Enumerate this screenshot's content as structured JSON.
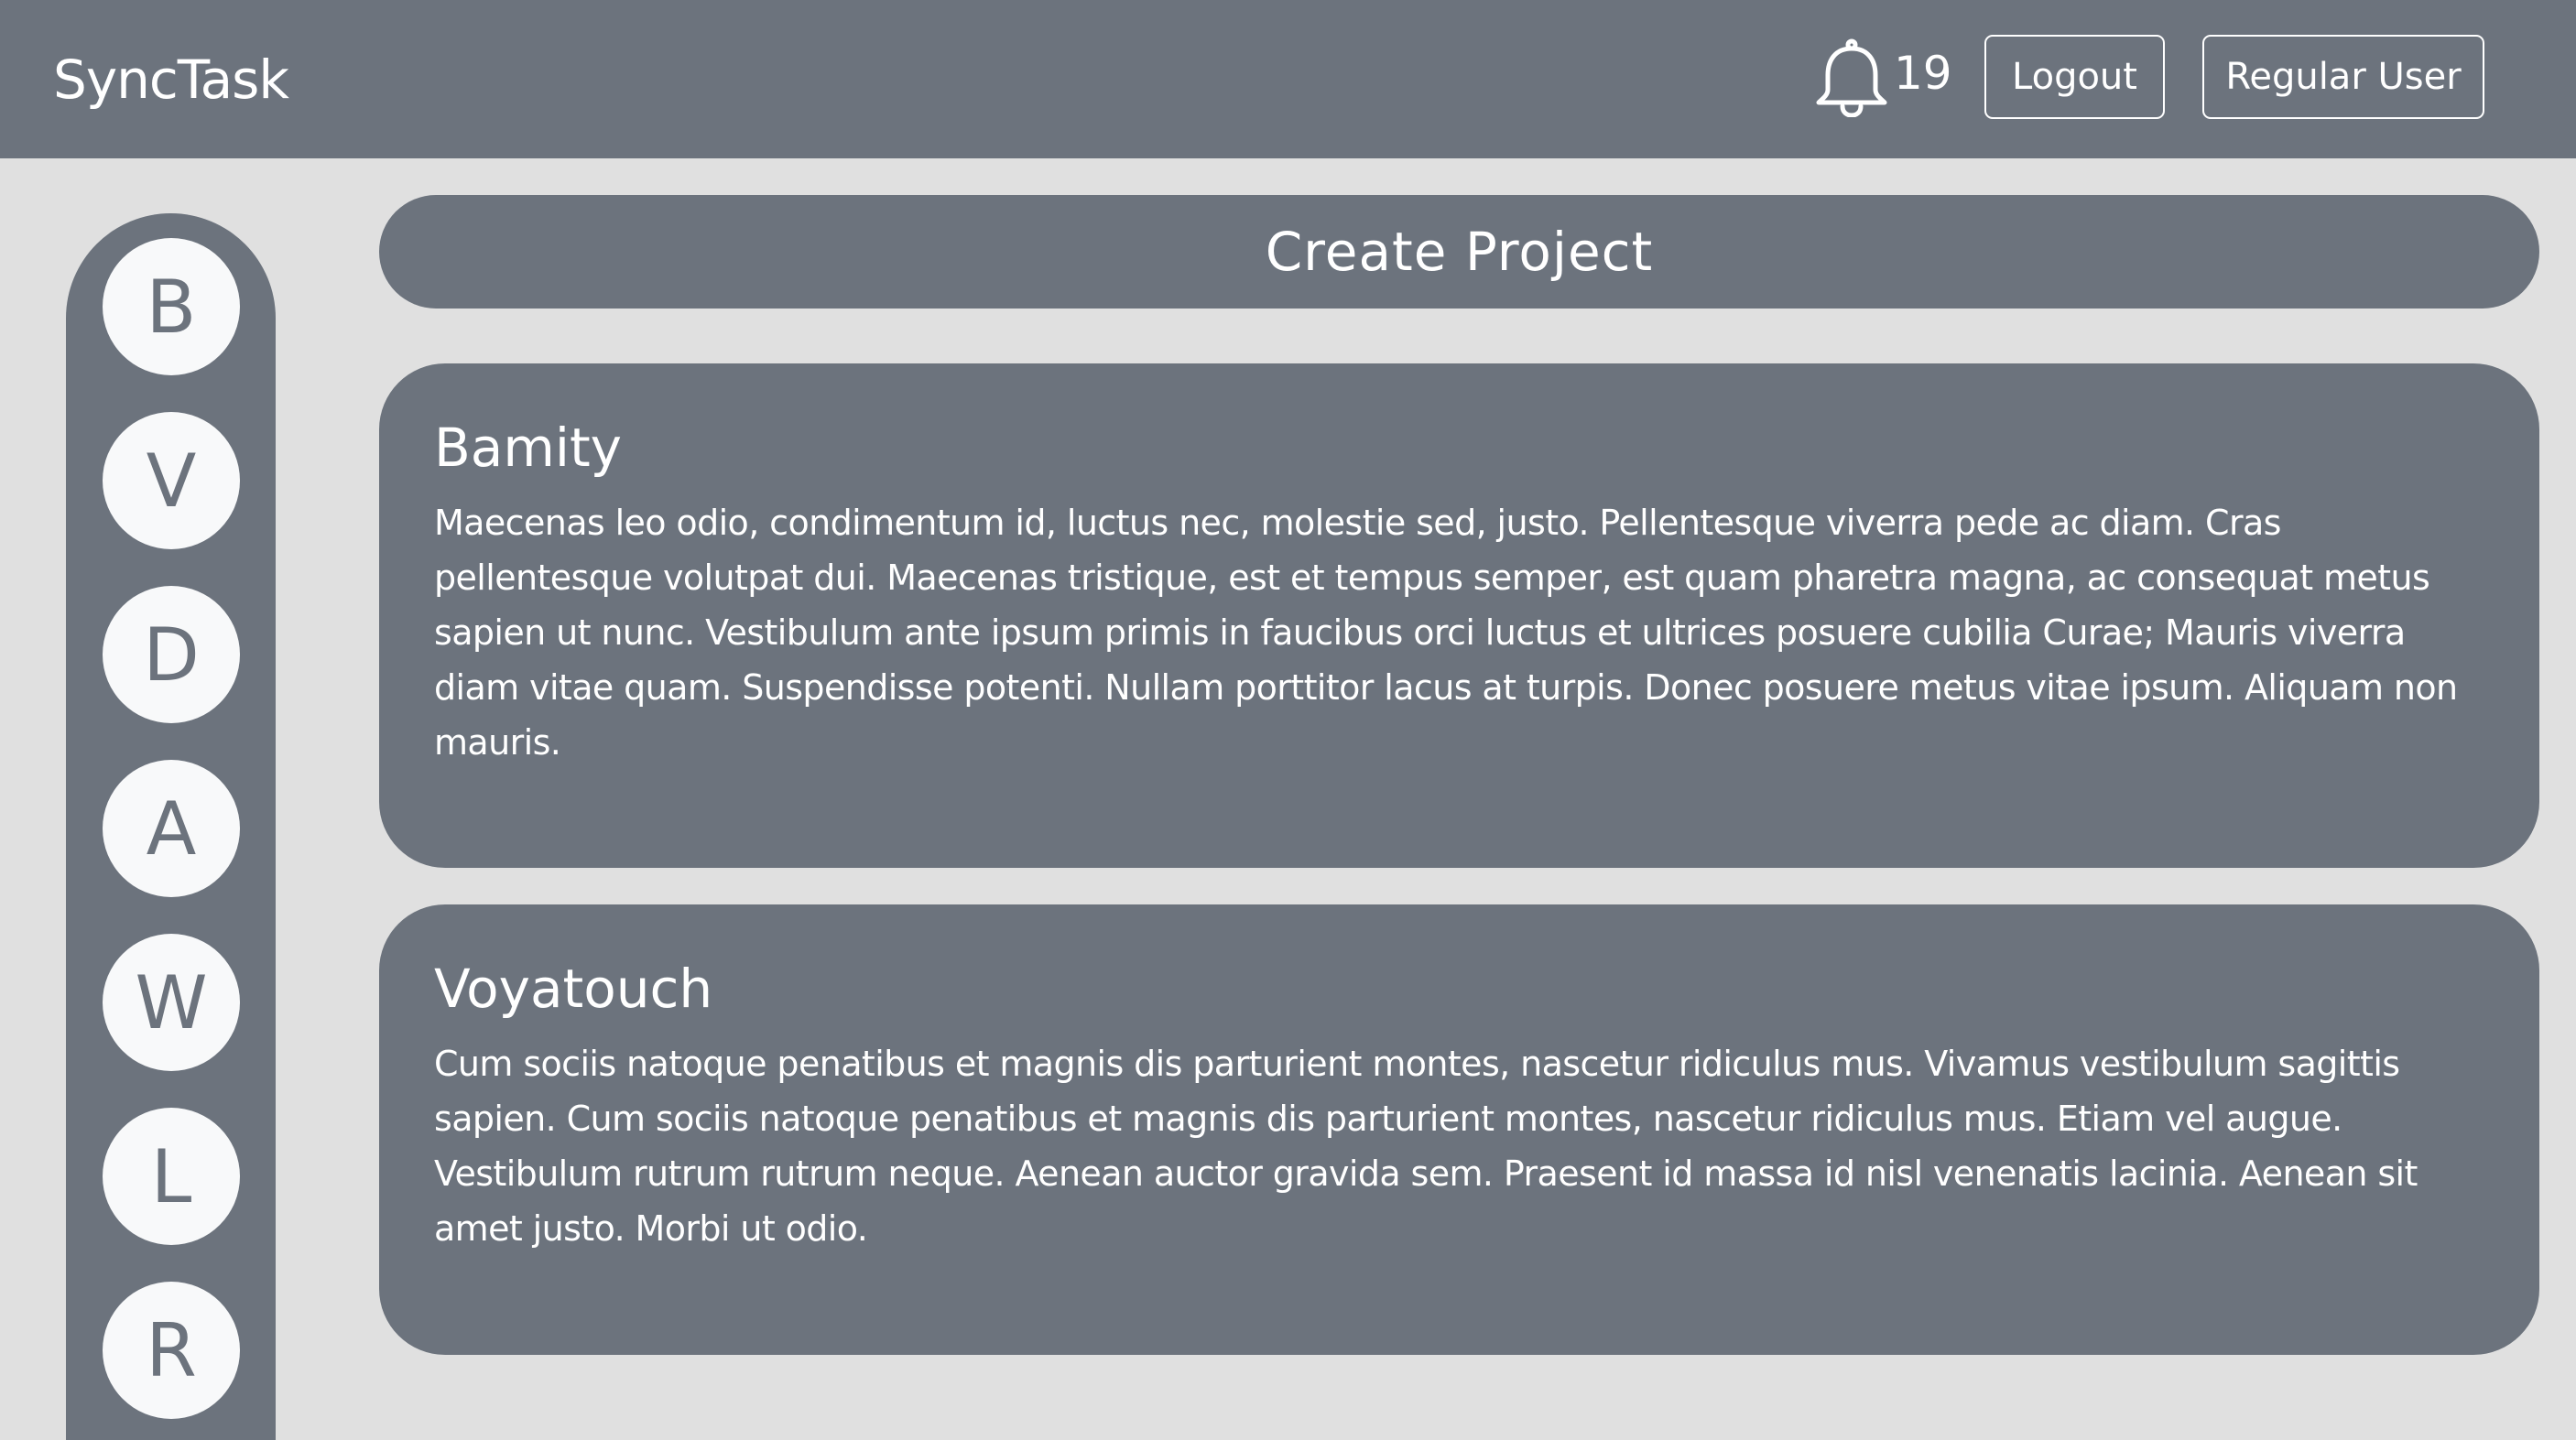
{
  "header": {
    "brand": "SyncTask",
    "notification_count": "19",
    "logout_label": "Logout",
    "user_label": "Regular User"
  },
  "sidebar": {
    "avatars": [
      "B",
      "V",
      "D",
      "A",
      "W",
      "L",
      "R"
    ]
  },
  "create_project_label": "Create Project",
  "projects": [
    {
      "name": "Bamity",
      "description": "Maecenas leo odio, condimentum id, luctus nec, molestie sed, justo. Pellentesque viverra pede ac diam. Cras pellentesque volutpat dui. Maecenas tristique, est et tempus semper, est quam pharetra magna, ac consequat metus sapien ut nunc. Vestibulum ante ipsum primis in faucibus orci luctus et ultrices posuere cubilia Curae; Mauris viverra diam vitae quam. Suspendisse potenti. Nullam porttitor lacus at turpis. Donec posuere metus vitae ipsum. Aliquam non mauris."
    },
    {
      "name": "Voyatouch",
      "description": "Cum sociis natoque penatibus et magnis dis parturient montes, nascetur ridiculus mus. Vivamus vestibulum sagittis sapien. Cum sociis natoque penatibus et magnis dis parturient montes, nascetur ridiculus mus. Etiam vel augue. Vestibulum rutrum rutrum neque. Aenean auctor gravida sem. Praesent id massa id nisl venenatis lacinia. Aenean sit amet justo. Morbi ut odio."
    }
  ],
  "colors": {
    "primary": "#6c737d",
    "background": "#e0e0e0",
    "avatar_bg": "#f8f9fa",
    "text_light": "#ffffff"
  },
  "icons": {
    "notifications": "bell-icon"
  }
}
